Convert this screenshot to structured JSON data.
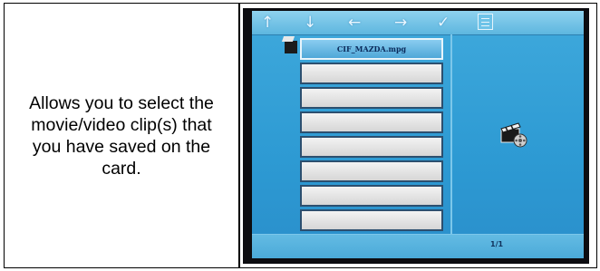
{
  "description": {
    "text": "Allows you to select the movie/video clip(s) that you have saved on the card."
  },
  "screen": {
    "toolbar_icons": [
      "arrow-up-icon",
      "arrow-down-icon",
      "arrow-left-icon",
      "arrow-right-icon",
      "checkmark-icon",
      "list-icon"
    ],
    "toolbar_glyphs": [
      "↑",
      "↓",
      "←",
      "→",
      "✓"
    ],
    "file_list": {
      "rows": [
        {
          "label": "CIF_MAZDA.mpg",
          "selected": true
        },
        {
          "label": "",
          "selected": false
        },
        {
          "label": "",
          "selected": false
        },
        {
          "label": "",
          "selected": false
        },
        {
          "label": "",
          "selected": false
        },
        {
          "label": "",
          "selected": false
        },
        {
          "label": "",
          "selected": false
        },
        {
          "label": "",
          "selected": false
        }
      ]
    },
    "page_indicator": "1/1",
    "preview_icon": "movie-clapper-icon",
    "colors": {
      "screen_background": "#2d9ad3",
      "selected_row": "#6bbbe6",
      "row_background": "#e4e4e4"
    }
  }
}
